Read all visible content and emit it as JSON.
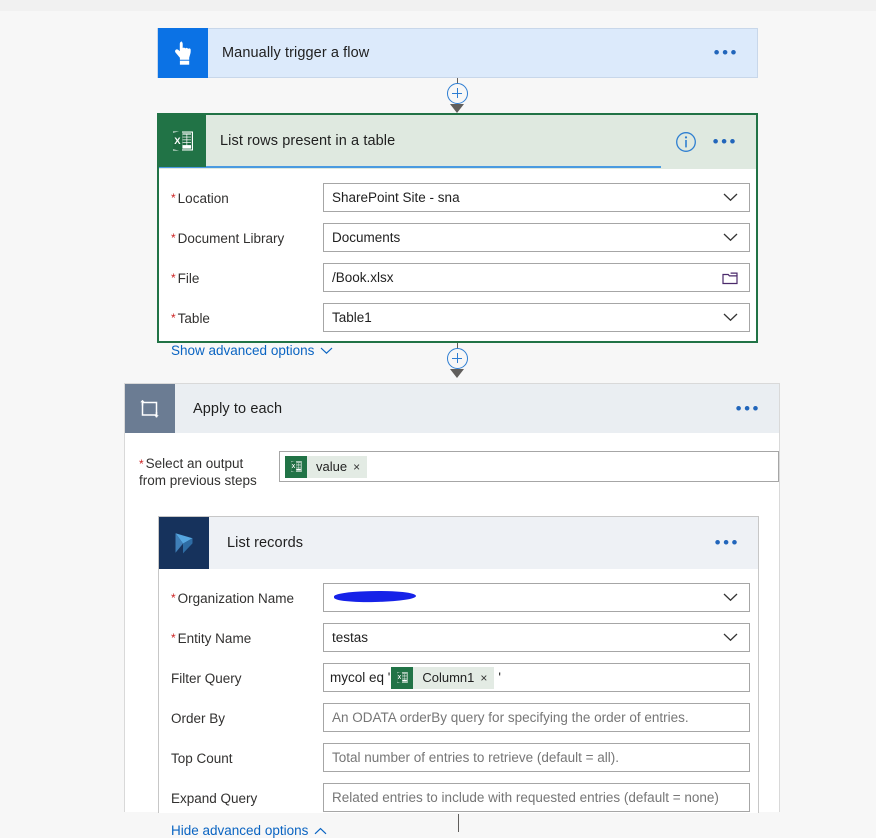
{
  "app": {
    "surface": "power-automate-flow-designer"
  },
  "trigger_card": {
    "icon": "touch-hand-icon",
    "title": "Manually trigger a flow",
    "menu": "•••",
    "accent": "#0b72e5"
  },
  "excel_card": {
    "icon": "excel-icon",
    "title": "List rows present in a table",
    "info": "i",
    "menu": "•••",
    "accent": "#217346",
    "fields": [
      {
        "label": "Location",
        "required": true,
        "value": "SharePoint Site - sna",
        "control": "dropdown",
        "placeholder": ""
      },
      {
        "label": "Document Library",
        "required": true,
        "value": "Documents",
        "control": "dropdown",
        "placeholder": ""
      },
      {
        "label": "File",
        "required": true,
        "value": "/Book.xlsx",
        "control": "filepicker",
        "placeholder": ""
      },
      {
        "label": "Table",
        "required": true,
        "value": "Table1",
        "control": "dropdown",
        "placeholder": ""
      }
    ],
    "advanced_link": "Show advanced options",
    "advanced_state": "collapsed"
  },
  "apply_card": {
    "icon": "loop-icon",
    "title": "Apply to each",
    "menu": "•••",
    "accent": "#6b7c93",
    "select_output": {
      "label_line1": "Select an output",
      "label_line2": "from previous steps",
      "required": true,
      "token": {
        "label": "value",
        "icon": "excel-icon",
        "remove": "×"
      }
    }
  },
  "dynamics_card": {
    "icon": "dynamics365-icon",
    "title": "List records",
    "menu": "•••",
    "accent": "#16325c",
    "fields": [
      {
        "label": "Organization Name",
        "required": true,
        "value": "",
        "control": "dropdown",
        "redacted": true,
        "placeholder": ""
      },
      {
        "label": "Entity Name",
        "required": true,
        "value": "testas",
        "control": "dropdown",
        "placeholder": ""
      },
      {
        "label": "Filter Query",
        "required": false,
        "value": "",
        "control": "tokenized",
        "prefix": "mycol eq '",
        "suffix": "'",
        "token": {
          "label": "Column1",
          "icon": "excel-icon",
          "remove": "×"
        },
        "placeholder": ""
      },
      {
        "label": "Order By",
        "required": false,
        "value": "",
        "control": "text",
        "placeholder": "An ODATA orderBy query for specifying the order of entries."
      },
      {
        "label": "Top Count",
        "required": false,
        "value": "",
        "control": "text",
        "placeholder": "Total number of entries to retrieve (default = all)."
      },
      {
        "label": "Expand Query",
        "required": false,
        "value": "",
        "control": "text",
        "placeholder": "Related entries to include with requested entries (default = none)"
      }
    ],
    "advanced_link": "Hide advanced options",
    "advanced_state": "expanded"
  },
  "connectors": [
    {
      "name": "trigger-to-excel",
      "add_step": "+"
    },
    {
      "name": "excel-to-apply",
      "add_step": "+"
    }
  ],
  "colors": {
    "canvas_bg": "#f7f7f7",
    "trigger_bg": "#dceafb",
    "excel_border": "#217346",
    "excel_header_bg": "#dfe9e0",
    "selection_underline": "#4a9ae0",
    "apply_header_bg": "#eaeef2",
    "dynamics_header_bg": "#eef1f5",
    "link_blue": "#0a64c2",
    "required_red": "#cc2222",
    "redaction": "#1622e8"
  }
}
